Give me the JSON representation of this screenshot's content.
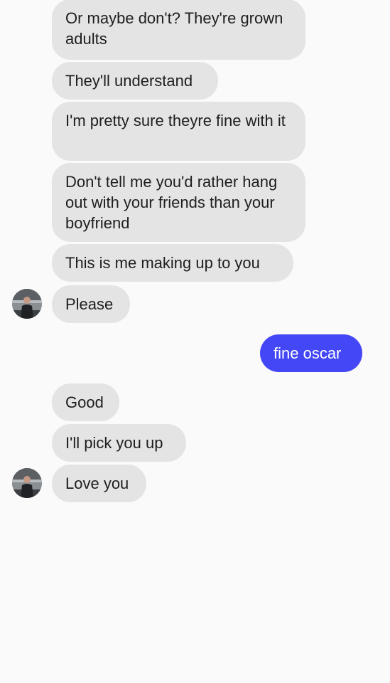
{
  "conversation": {
    "messages": [
      {
        "text": "Or maybe don't? They're grown adults",
        "direction": "incoming"
      },
      {
        "text": "They'll understand",
        "direction": "incoming"
      },
      {
        "text": "I'm pretty sure theyre fine with it",
        "direction": "incoming"
      },
      {
        "text": "Don't tell me you'd rather hang out with your friends than your boyfriend",
        "direction": "incoming"
      },
      {
        "text": "This is me making up to you",
        "direction": "incoming"
      },
      {
        "text": "Please",
        "direction": "incoming"
      },
      {
        "text": "fine oscar",
        "direction": "outgoing"
      },
      {
        "text": "Good",
        "direction": "incoming"
      },
      {
        "text": "I'll pick you up",
        "direction": "incoming"
      },
      {
        "text": "Love you",
        "direction": "incoming"
      }
    ]
  },
  "colors": {
    "background": "#fafafa",
    "incoming_bubble": "#e4e4e4",
    "outgoing_bubble": "#4447f5",
    "incoming_text": "#1e1e1e",
    "outgoing_text": "#ffffff"
  },
  "avatar": {
    "icon": "contact-avatar-icon"
  }
}
